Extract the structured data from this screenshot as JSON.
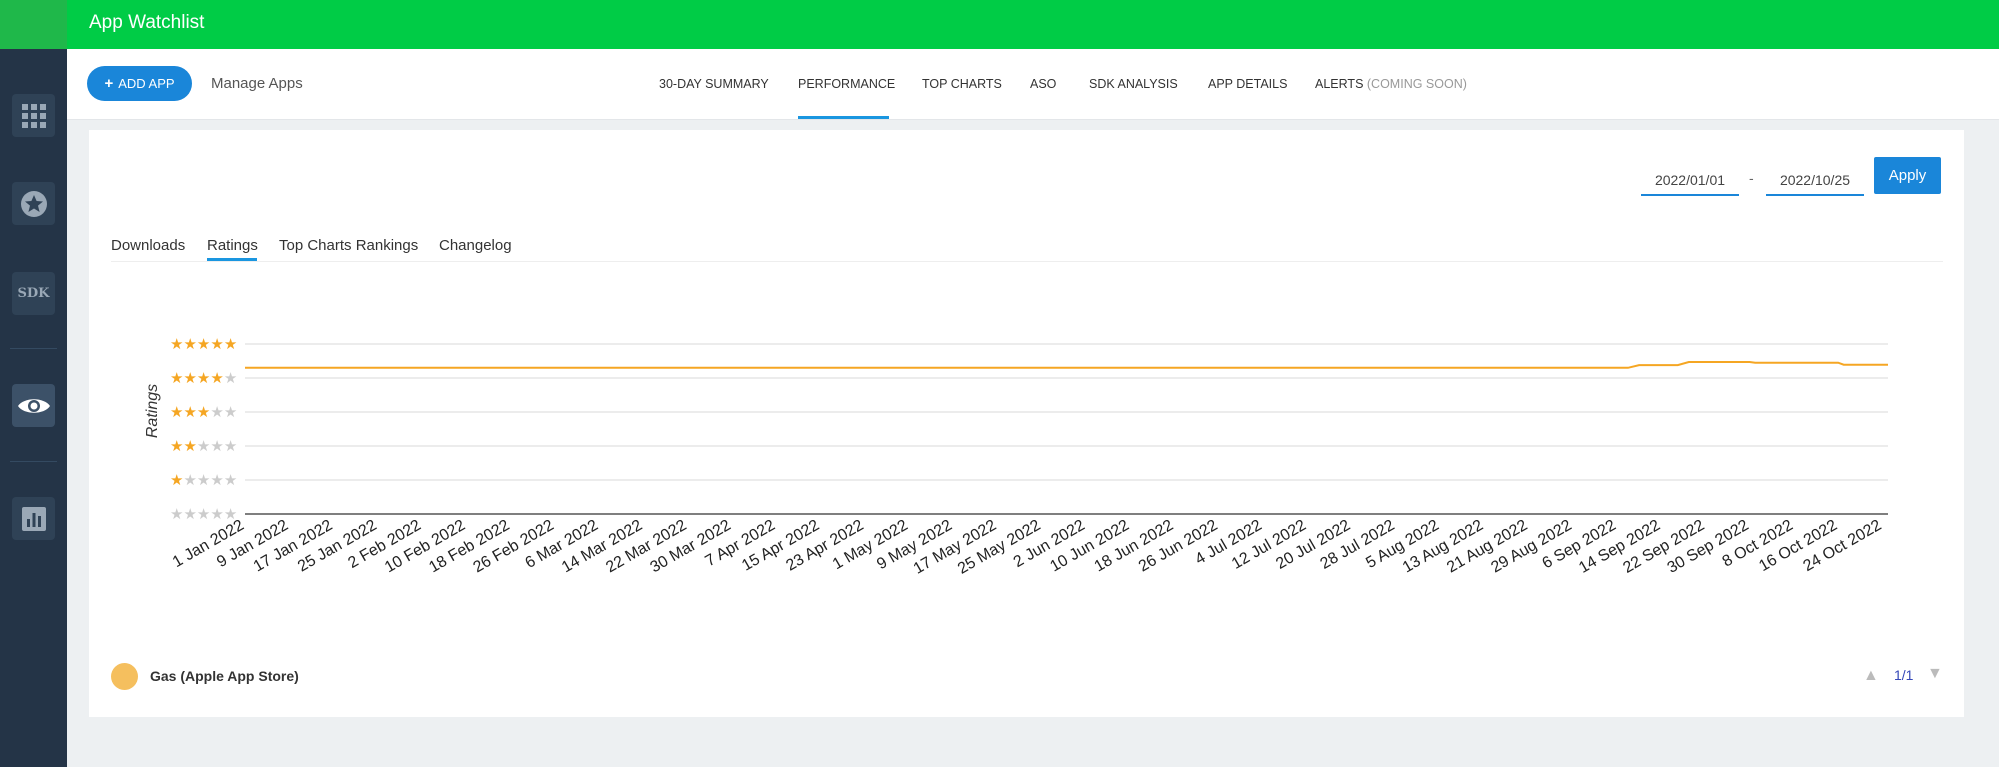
{
  "header": {
    "app_title": "App Watchlist"
  },
  "sidebar": {
    "items": [
      {
        "name": "grid-icon"
      },
      {
        "name": "star-badge-icon"
      },
      {
        "name": "sdk-icon",
        "label": "SDK"
      },
      {
        "name": "eye-icon"
      },
      {
        "name": "bar-chart-icon"
      }
    ]
  },
  "nav": {
    "add_label": "ADD APP",
    "manage_label": "Manage Apps",
    "tabs": [
      "30-DAY SUMMARY",
      "PERFORMANCE",
      "TOP CHARTS",
      "ASO",
      "SDK ANALYSIS",
      "APP DETAILS",
      "ALERTS"
    ],
    "alerts_suffix": "(COMING SOON)",
    "active_tab": "PERFORMANCE"
  },
  "filters": {
    "start_date": "2022/01/01",
    "separator": "-",
    "end_date": "2022/10/25",
    "apply_label": "Apply"
  },
  "subtabs": {
    "items": [
      "Downloads",
      "Ratings",
      "Top Charts Rankings",
      "Changelog"
    ],
    "active": "Ratings"
  },
  "chart_data": {
    "type": "line",
    "ylabel": "Ratings",
    "ylim": [
      0,
      5
    ],
    "y_tick_labels": [
      "★★★★★",
      "★★★★★",
      "★★★★★",
      "★★★★★",
      "★★★★★",
      "★★★★★"
    ],
    "y_ticks_filled": [
      0,
      1,
      2,
      3,
      4,
      5
    ],
    "x_tick_labels": [
      "1 Jan 2022",
      "9 Jan 2022",
      "17 Jan 2022",
      "25 Jan 2022",
      "2 Feb 2022",
      "10 Feb 2022",
      "18 Feb 2022",
      "26 Feb 2022",
      "6 Mar 2022",
      "14 Mar 2022",
      "22 Mar 2022",
      "30 Mar 2022",
      "7 Apr 2022",
      "15 Apr 2022",
      "23 Apr 2022",
      "1 May 2022",
      "9 May 2022",
      "17 May 2022",
      "25 May 2022",
      "2 Jun 2022",
      "10 Jun 2022",
      "18 Jun 2022",
      "26 Jun 2022",
      "4 Jul 2022",
      "12 Jul 2022",
      "20 Jul 2022",
      "28 Jul 2022",
      "5 Aug 2022",
      "13 Aug 2022",
      "21 Aug 2022",
      "29 Aug 2022",
      "6 Sep 2022",
      "14 Sep 2022",
      "22 Sep 2022",
      "30 Sep 2022",
      "8 Oct 2022",
      "16 Oct 2022",
      "24 Oct 2022"
    ],
    "series": [
      {
        "name": "Gas (Apple App Store)",
        "color": "#f5a623",
        "x": [
          "2022-01-01",
          "2022-09-08",
          "2022-09-10",
          "2022-09-17",
          "2022-09-19",
          "2022-09-30",
          "2022-10-01",
          "2022-10-16",
          "2022-10-17",
          "2022-10-25"
        ],
        "y": [
          4.3,
          4.3,
          4.38,
          4.38,
          4.47,
          4.47,
          4.45,
          4.45,
          4.39,
          4.39
        ]
      }
    ],
    "grid": true,
    "legend_placement": "bottom-left"
  },
  "legend": {
    "label": "Gas (Apple App Store)",
    "color": "#f5bf5e"
  },
  "pager": {
    "text": "1/1"
  },
  "colors": {
    "brand": "#00cc46",
    "accent": "#1a86d9",
    "sidebar": "#243447",
    "star": "#f5a623"
  }
}
